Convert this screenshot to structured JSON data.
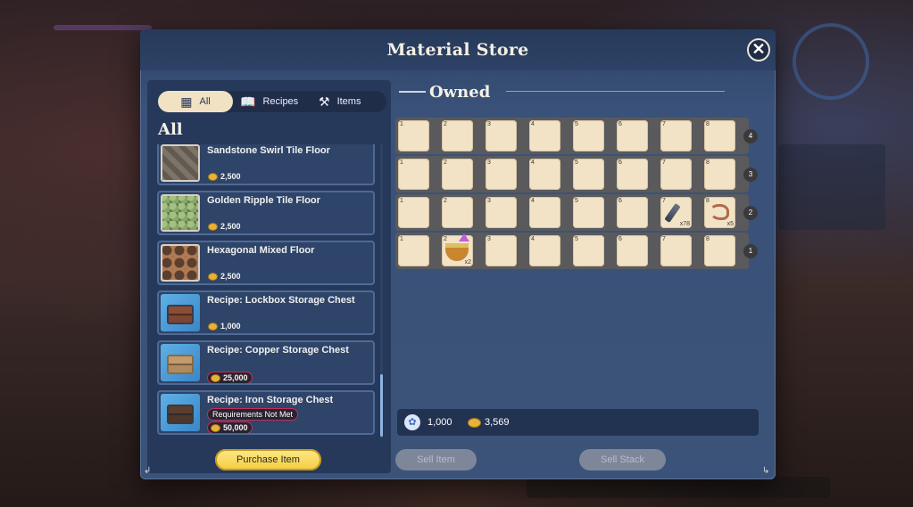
{
  "window": {
    "title": "Material Store",
    "close_label": "✕"
  },
  "tabs": [
    {
      "label": "All",
      "icon": "grid-icon"
    },
    {
      "label": "Recipes",
      "icon": "book-icon"
    },
    {
      "label": "Items",
      "icon": "crafting-icon"
    }
  ],
  "list_heading": "All",
  "items": [
    {
      "name": "Sandstone Swirl Tile Floor",
      "price": "2,500",
      "thumb": "t-stone"
    },
    {
      "name": "Golden Ripple Tile Floor",
      "price": "2,500",
      "thumb": "t-green"
    },
    {
      "name": "Hexagonal Mixed Floor",
      "price": "2,500",
      "thumb": "t-hex"
    },
    {
      "name": "Recipe: Lockbox Storage Chest",
      "price": "1,000",
      "thumb": "t-blue"
    },
    {
      "name": "Recipe: Copper Storage Chest",
      "price": "25,000",
      "thumb": "t-blue"
    },
    {
      "name": "Recipe: Iron Storage Chest",
      "price": "50,000",
      "thumb": "t-blue",
      "requirement": "Requirements Not Met"
    }
  ],
  "buttons": {
    "purchase": "Purchase Item",
    "sell": "Sell Item",
    "sell_stack": "Sell Stack"
  },
  "owned": {
    "heading": "Owned",
    "rows": [
      {
        "tag": "4",
        "slots": [
          "1",
          "2",
          "3",
          "4",
          "5",
          "6",
          "7",
          "8"
        ]
      },
      {
        "tag": "3",
        "slots": [
          "1",
          "2",
          "3",
          "4",
          "5",
          "6",
          "7",
          "8"
        ]
      },
      {
        "tag": "2",
        "slots": [
          "1",
          "2",
          "3",
          "4",
          "5",
          "6",
          "7",
          "8"
        ],
        "items": {
          "7": {
            "icon": "knife-icon",
            "qty": "x78"
          },
          "8": {
            "icon": "rope-icon",
            "qty": "x5"
          }
        }
      },
      {
        "tag": "1",
        "slots": [
          "1",
          "2",
          "3",
          "4",
          "5",
          "6",
          "7",
          "8"
        ],
        "items": {
          "2": {
            "icon": "food-bowl-icon",
            "qty": "x2"
          }
        }
      }
    ]
  },
  "wallet": {
    "tickets": "1,000",
    "gold": "3,569"
  }
}
